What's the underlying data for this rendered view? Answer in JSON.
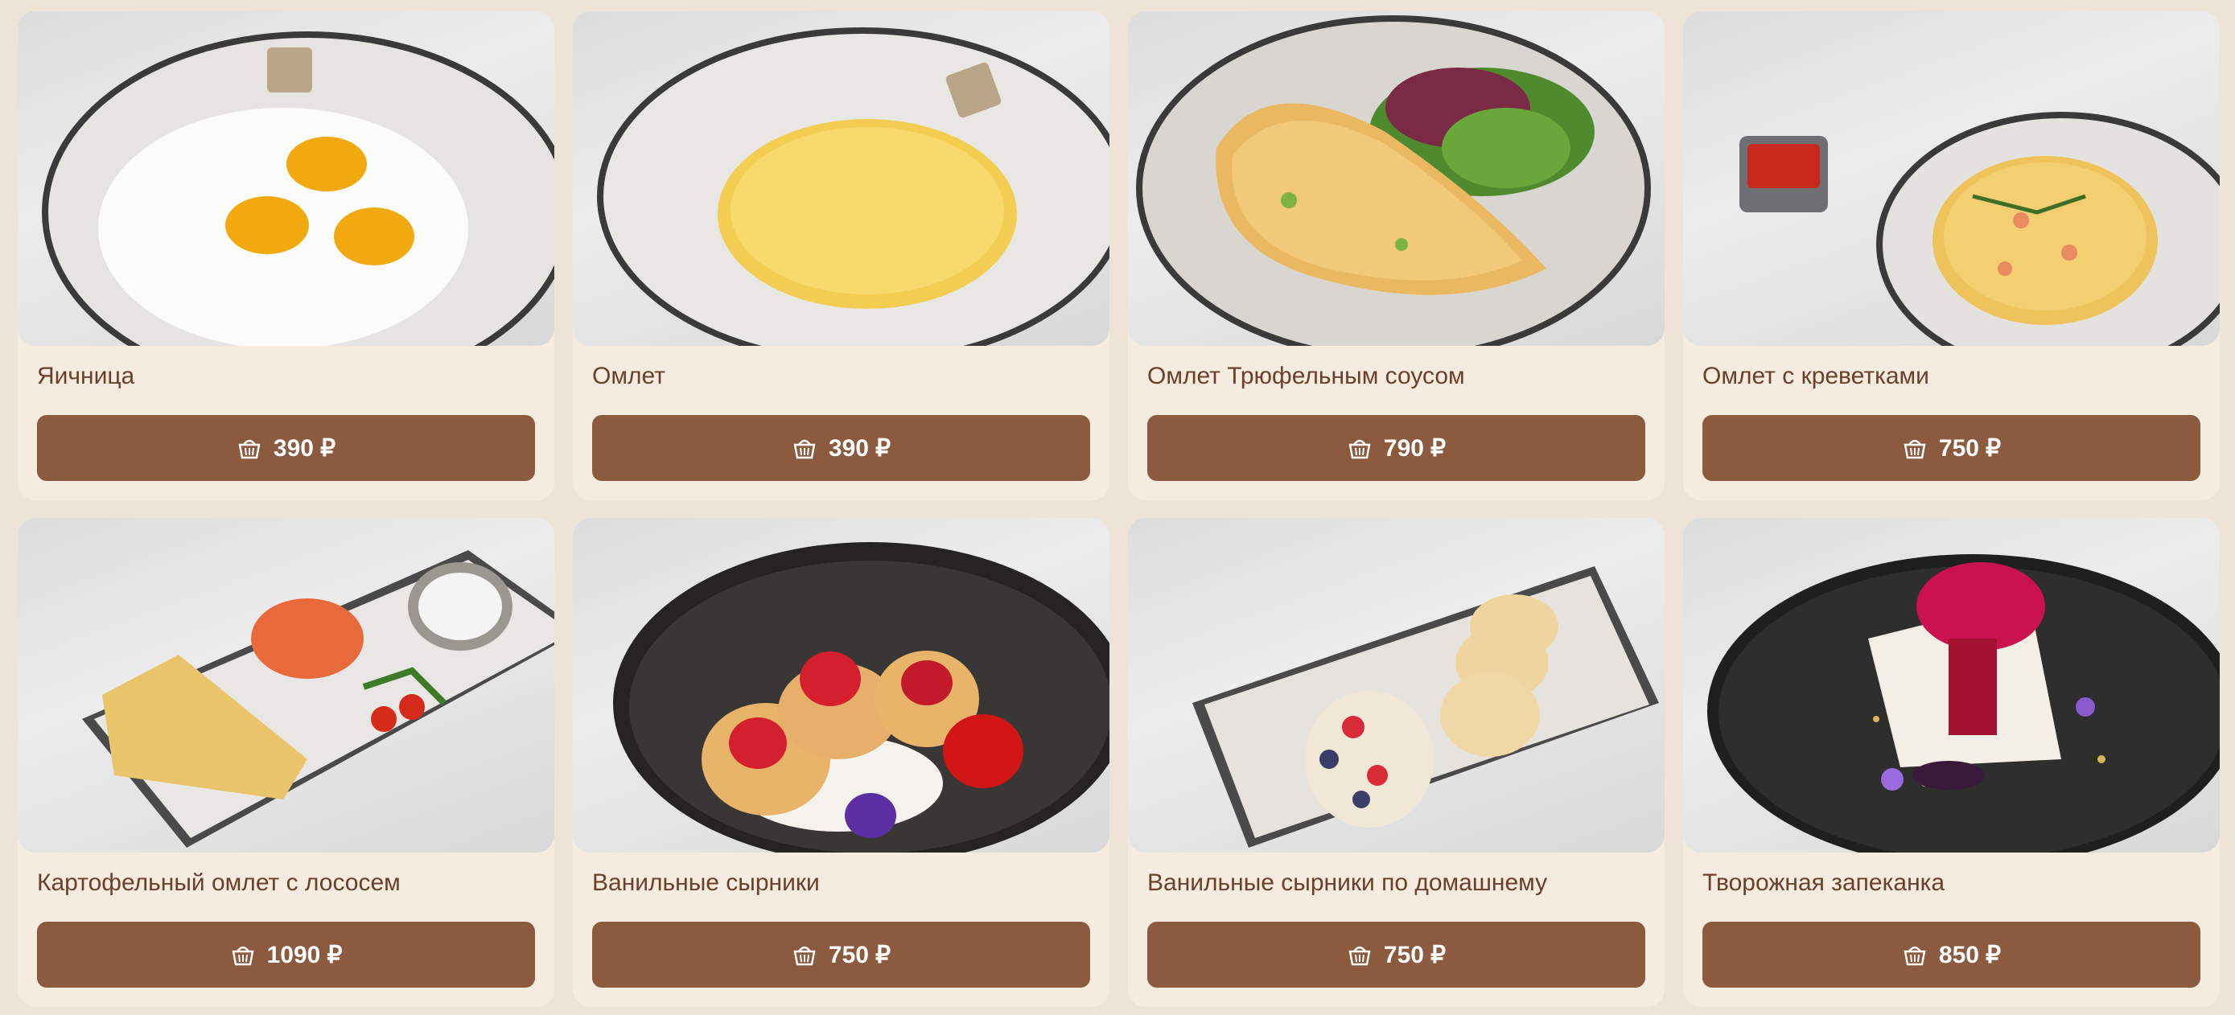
{
  "products": [
    {
      "name": "Яичница",
      "price": "390",
      "currency": "₽",
      "photo": "fried-eggs-photo"
    },
    {
      "name": "Омлет",
      "price": "390",
      "currency": "₽",
      "photo": "omelette-photo"
    },
    {
      "name": "Омлет Трюфельным соусом",
      "price": "790",
      "currency": "₽",
      "photo": "truffle-omelette-photo"
    },
    {
      "name": "Омлет с креветками",
      "price": "750",
      "currency": "₽",
      "photo": "shrimp-omelette-photo"
    },
    {
      "name": "Картофельный омлет с лососем",
      "price": "1090",
      "currency": "₽",
      "photo": "potato-omelette-salmon-photo"
    },
    {
      "name": "Ванильные сырники",
      "price": "750",
      "currency": "₽",
      "photo": "vanilla-syrniki-photo"
    },
    {
      "name": "Ванильные сырники по домашнему",
      "price": "750",
      "currency": "₽",
      "photo": "homestyle-syrniki-photo"
    },
    {
      "name": "Творожная запеканка",
      "price": "850",
      "currency": "₽",
      "photo": "cottage-cheese-casserole-photo"
    }
  ],
  "colors": {
    "page_bg": "#ede3d6",
    "card_bg": "#f5ebdf",
    "button_bg": "#8b5a3f",
    "title_text": "#6b3f2a",
    "button_text": "#ffffff"
  },
  "icons": {
    "buy_button": "basket-icon"
  }
}
